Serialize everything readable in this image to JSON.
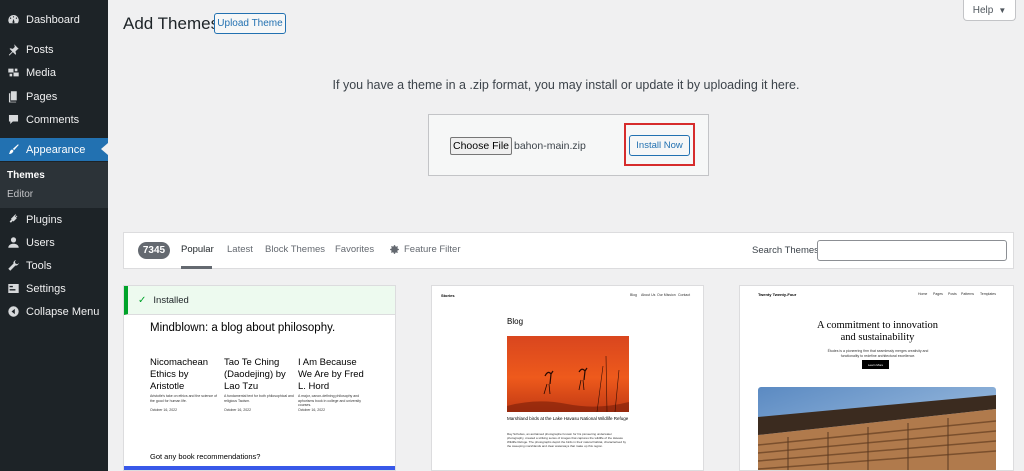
{
  "sidebar": {
    "items": [
      {
        "label": "Dashboard",
        "icon": "dashboard-icon"
      },
      {
        "label": "Posts",
        "icon": "pin-icon"
      },
      {
        "label": "Media",
        "icon": "media-icon"
      },
      {
        "label": "Pages",
        "icon": "pages-icon"
      },
      {
        "label": "Comments",
        "icon": "comment-icon"
      },
      {
        "label": "Appearance",
        "icon": "paintbrush-icon"
      },
      {
        "label": "Plugins",
        "icon": "plug-icon"
      },
      {
        "label": "Users",
        "icon": "user-icon"
      },
      {
        "label": "Tools",
        "icon": "wrench-icon"
      },
      {
        "label": "Settings",
        "icon": "settings-icon"
      },
      {
        "label": "Collapse Menu",
        "icon": "collapse-icon"
      }
    ],
    "submenu": [
      "Themes",
      "Editor"
    ]
  },
  "header": {
    "title": "Add Themes",
    "upload_button": "Upload Theme",
    "help": "Help"
  },
  "upload": {
    "description": "If you have a theme in a .zip format, you may install or update it by uploading it here.",
    "choose_file": "Choose File",
    "file_name": "bahon-main.zip",
    "install_button": "Install Now"
  },
  "filter": {
    "count": "7345",
    "tabs": [
      "Popular",
      "Latest",
      "Block Themes",
      "Favorites"
    ],
    "feature_filter": "Feature Filter",
    "search_label": "Search Themes",
    "search_value": ""
  },
  "themes": {
    "card1": {
      "installed": "Installed",
      "heading": "Mindblown: a blog about philosophy.",
      "posts": [
        {
          "title": "Nicomachean Ethics by Aristotle",
          "excerpt": "Aristotle's take on ethics and the science of the good for human life.",
          "date": "October 16, 2022"
        },
        {
          "title": "Tao Te Ching (Daodejing) by Lao Tzu",
          "excerpt": "A fundamental text for both philosophical and religious Taoism.",
          "date": "October 16, 2022"
        },
        {
          "title": "I Am Because We Are by Fred L. Hord",
          "excerpt": "A major, canon-defining philosophy and aphorisms book in college and university courses.",
          "date": "October 16, 2022"
        }
      ],
      "footer": "Got any book recommendations?"
    },
    "card2": {
      "brand": "Stories",
      "nav": [
        "Blog",
        "About Us",
        "Our Mission",
        "Contact"
      ],
      "heading": "Blog",
      "caption": "Marshland birds at the Lake Havasu National Wildlife Refuge",
      "body": "Ray Schultes, an acclaimed photographer known for his pioneering underwater photography, created a striking series of images that captures the wildlife of the Havasu Wildlife Refuge. The photographs depict the birds in their natural habitat, characterised by the sweeping marshlands and clear waterways that make up this region."
    },
    "card3": {
      "brand": "Twenty Twenty-Four",
      "nav": [
        "Home",
        "Pages",
        "Posts",
        "Patterns",
        "Templates"
      ],
      "headline": "A commitment to innovation and sustainability",
      "subtext": "Études is a pioneering firm that seamlessly merges creativity and functionality to redefine architectural excellence.",
      "button": "Learn More"
    }
  },
  "colors": {
    "sidebar_bg": "#1d2327",
    "accent": "#2271b1",
    "highlight_red": "#d62c2c",
    "installed_green": "#00a32a"
  }
}
